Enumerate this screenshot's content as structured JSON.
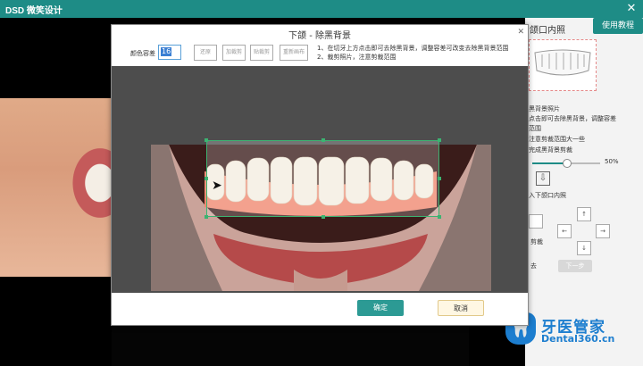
{
  "app": {
    "title": "DSD 微笑设计"
  },
  "dialog": {
    "title": "下颌 - 除黑背景",
    "tolerance_label": "颜色容差",
    "tolerance_value": "16",
    "tools": [
      "还原",
      "加裁剪",
      "贴裁剪",
      "重新画布"
    ],
    "instructions": [
      "1、在切牙上方点击即可去除黑背景，调整容差可改变去除黑背景范围",
      "2、裁剪照片，注意剪裁范围"
    ],
    "ok_label": "确定",
    "cancel_label": "取消"
  },
  "right_panel": {
    "help_label": "使用教程",
    "title": "颌口内照",
    "lines": [
      "黑背景照片",
      "点击即可去除黑背景，调整容差",
      "范围",
      "注意剪裁范围大一些",
      "完成黑背景剪裁"
    ],
    "slider_value": 50,
    "slider_label": "50%",
    "upload_label": "入下颌口内照",
    "side_labels": [
      "去",
      "剪裁"
    ],
    "next_label": "下一步"
  },
  "watermark": {
    "cn": "牙医管家",
    "en": "Dental360.cn"
  }
}
